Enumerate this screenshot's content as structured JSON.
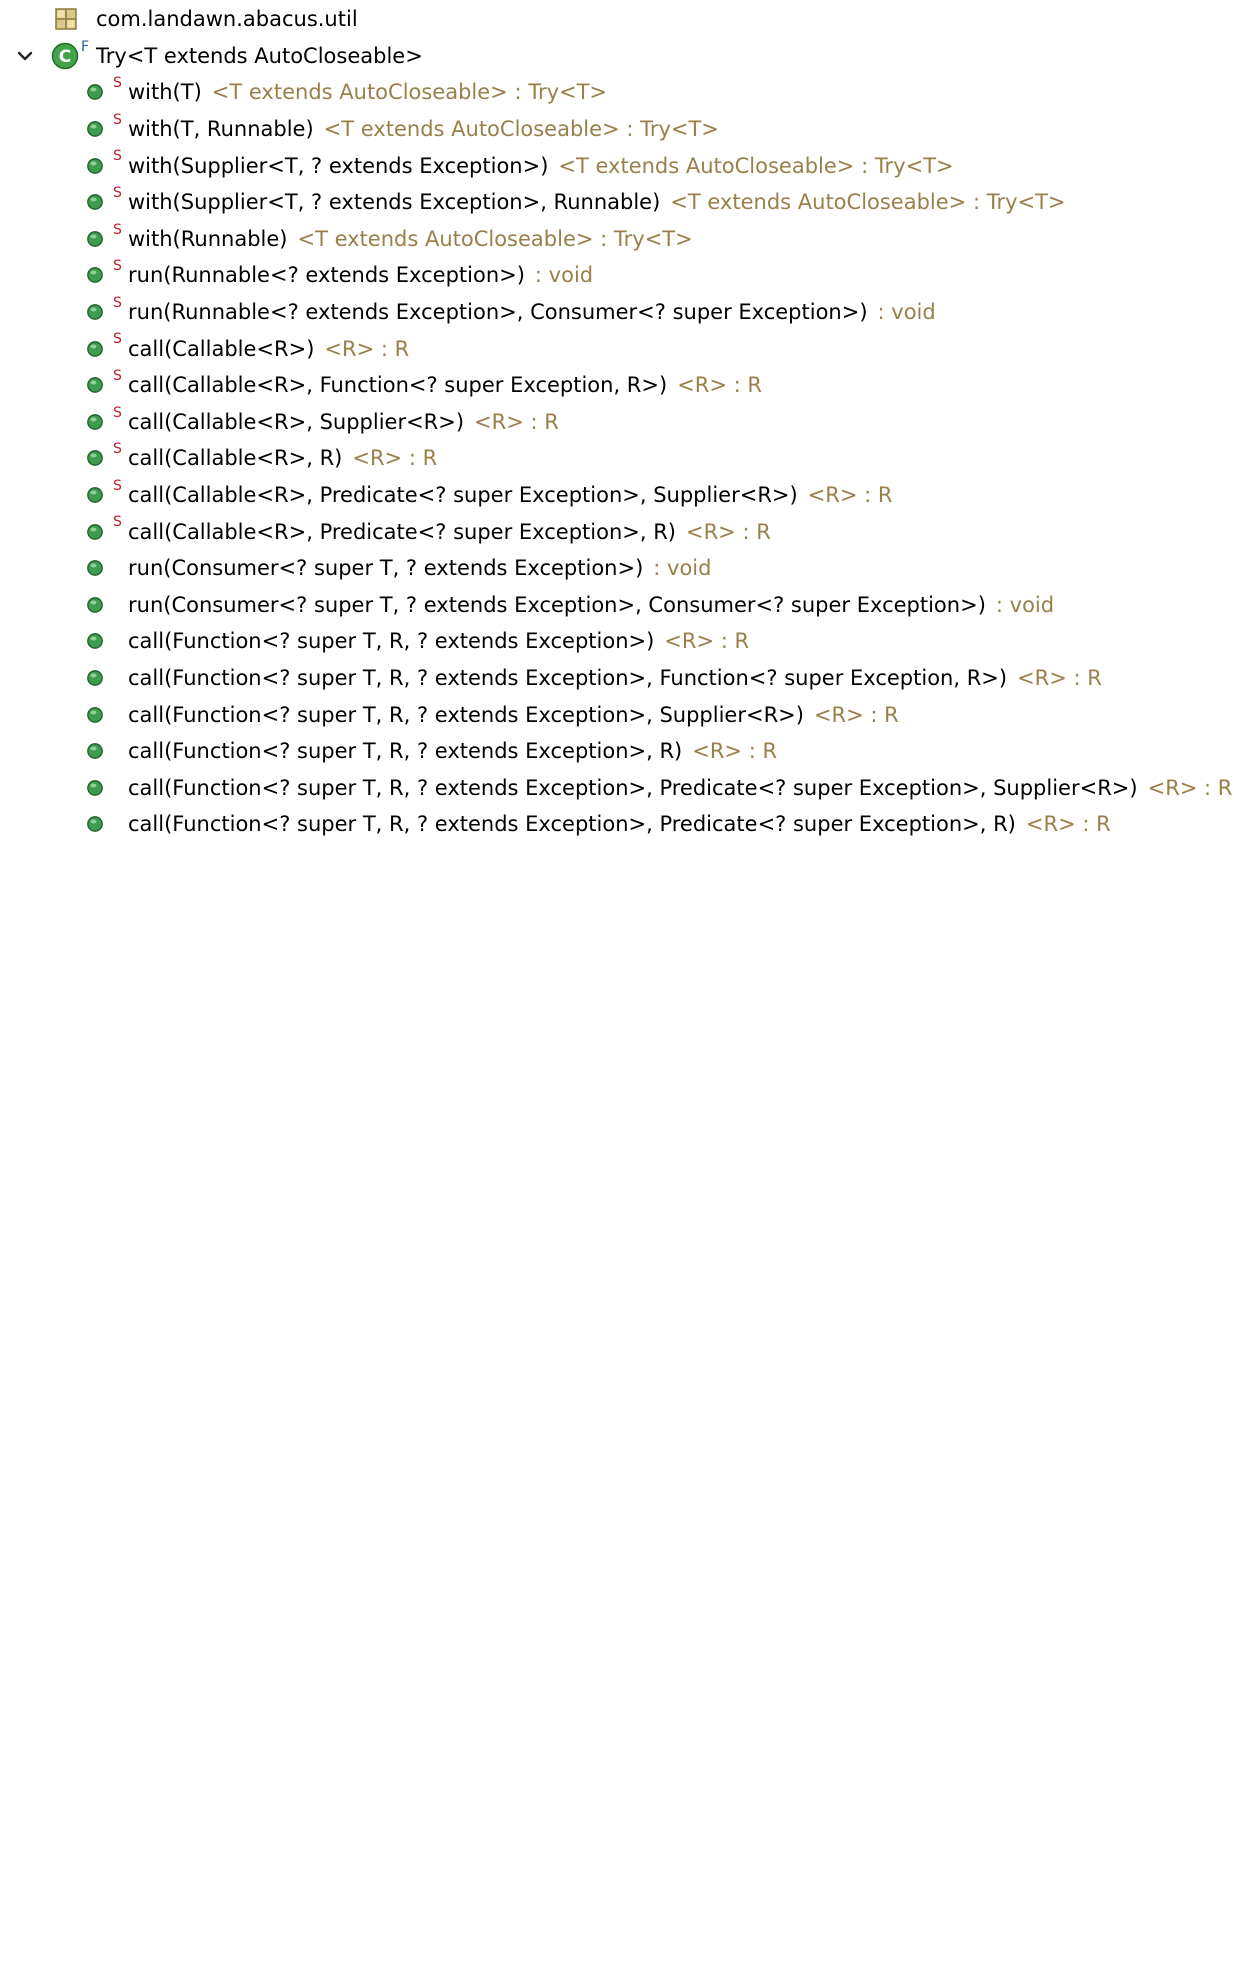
{
  "outline": {
    "package": {
      "label": "com.landawn.abacus.util",
      "icon": "package-icon"
    },
    "class": {
      "label": "Try<T extends AutoCloseable>",
      "flag": "F",
      "icon": "class-icon",
      "expanded": true
    },
    "colors": {
      "signature": "#000000",
      "return_type": "#9a7f4a",
      "static_flag": "#c0202c",
      "method_dot": "#3f9b50"
    },
    "methods": [
      {
        "signature": "with(T)",
        "return": "<T extends AutoCloseable> : Try<T>",
        "static_flag": "S"
      },
      {
        "signature": "with(T, Runnable)",
        "return": "<T extends AutoCloseable> : Try<T>",
        "static_flag": "S"
      },
      {
        "signature": "with(Supplier<T, ? extends Exception>)",
        "return": "<T extends AutoCloseable> : Try<T>",
        "static_flag": "S"
      },
      {
        "signature": "with(Supplier<T, ? extends Exception>, Runnable)",
        "return": "<T extends AutoCloseable> : Try<T>",
        "static_flag": "S"
      },
      {
        "signature": "with(Runnable)",
        "return": "<T extends AutoCloseable> : Try<T>",
        "static_flag": "S"
      },
      {
        "signature": "run(Runnable<? extends Exception>)",
        "return": ": void",
        "static_flag": "S"
      },
      {
        "signature": "run(Runnable<? extends Exception>, Consumer<? super Exception>)",
        "return": ": void",
        "static_flag": "S"
      },
      {
        "signature": "call(Callable<R>)",
        "return": "<R> : R",
        "static_flag": "S"
      },
      {
        "signature": "call(Callable<R>, Function<? super Exception, R>)",
        "return": "<R> : R",
        "static_flag": "S"
      },
      {
        "signature": "call(Callable<R>, Supplier<R>)",
        "return": "<R> : R",
        "static_flag": "S"
      },
      {
        "signature": "call(Callable<R>, R)",
        "return": "<R> : R",
        "static_flag": "S"
      },
      {
        "signature": "call(Callable<R>, Predicate<? super Exception>, Supplier<R>)",
        "return": "<R> : R",
        "static_flag": "S"
      },
      {
        "signature": "call(Callable<R>, Predicate<? super Exception>, R)",
        "return": "<R> : R",
        "static_flag": "S"
      },
      {
        "signature": "run(Consumer<? super T, ? extends Exception>)",
        "return": ": void",
        "static_flag": ""
      },
      {
        "signature": "run(Consumer<? super T, ? extends Exception>, Consumer<? super Exception>)",
        "return": ": void",
        "static_flag": ""
      },
      {
        "signature": "call(Function<? super T, R, ? extends Exception>)",
        "return": "<R> : R",
        "static_flag": ""
      },
      {
        "signature": "call(Function<? super T, R, ? extends Exception>, Function<? super Exception, R>)",
        "return": "<R> : R",
        "static_flag": ""
      },
      {
        "signature": "call(Function<? super T, R, ? extends Exception>, Supplier<R>)",
        "return": "<R> : R",
        "static_flag": ""
      },
      {
        "signature": "call(Function<? super T, R, ? extends Exception>, R)",
        "return": "<R> : R",
        "static_flag": ""
      },
      {
        "signature": "call(Function<? super T, R, ? extends Exception>, Predicate<? super Exception>, Supplier<R>)",
        "return": "<R> : R",
        "static_flag": ""
      },
      {
        "signature": "call(Function<? super T, R, ? extends Exception>, Predicate<? super Exception>, R)",
        "return": "<R> : R",
        "static_flag": ""
      }
    ]
  }
}
